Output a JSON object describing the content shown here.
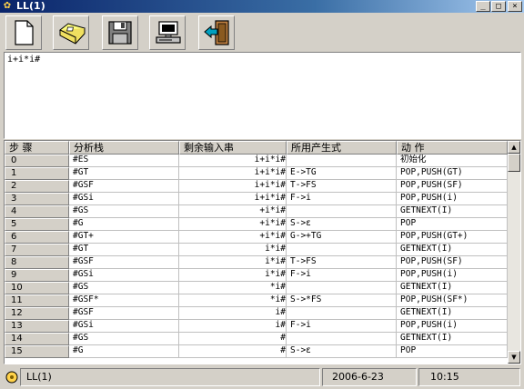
{
  "window": {
    "title": "LL(1)",
    "controls": [
      "_",
      "□",
      "×"
    ]
  },
  "toolbar": {
    "tools": [
      "new-file",
      "open-file",
      "save-file",
      "computer",
      "exit"
    ]
  },
  "editor": {
    "input_text": "i+i*i#"
  },
  "grid": {
    "headers": [
      "步  骤",
      "分析栈",
      "剩余输入串",
      "所用产生式",
      "动    作"
    ],
    "rows": [
      [
        "0",
        "#ES",
        "i+i*i#",
        "",
        "初始化"
      ],
      [
        "1",
        "#GT",
        "i+i*i#",
        "E->TG",
        "POP,PUSH(GT)"
      ],
      [
        "2",
        "#GSF",
        "i+i*i#",
        "T->FS",
        "POP,PUSH(SF)"
      ],
      [
        "3",
        "#GSi",
        "i+i*i#",
        "F->i",
        "POP,PUSH(i)"
      ],
      [
        "4",
        "#GS",
        "+i*i#",
        "",
        "GETNEXT(I)"
      ],
      [
        "5",
        "#G",
        "+i*i#",
        "S->ε",
        "POP"
      ],
      [
        "6",
        "#GT+",
        "+i*i#",
        "G->+TG",
        "POP,PUSH(GT+)"
      ],
      [
        "7",
        "#GT",
        "i*i#",
        "",
        "GETNEXT(I)"
      ],
      [
        "8",
        "#GSF",
        "i*i#",
        "T->FS",
        "POP,PUSH(SF)"
      ],
      [
        "9",
        "#GSi",
        "i*i#",
        "F->i",
        "POP,PUSH(i)"
      ],
      [
        "10",
        "#GS",
        "*i#",
        "",
        "GETNEXT(I)"
      ],
      [
        "11",
        "#GSF*",
        "*i#",
        "S->*FS",
        "POP,PUSH(SF*)"
      ],
      [
        "12",
        "#GSF",
        "i#",
        "",
        "GETNEXT(I)"
      ],
      [
        "13",
        "#GSi",
        "i#",
        "F->i",
        "POP,PUSH(i)"
      ],
      [
        "14",
        "#GS",
        "#",
        "",
        "GETNEXT(I)"
      ],
      [
        "15",
        "#G",
        "#",
        "S->ε",
        "POP"
      ]
    ]
  },
  "status": {
    "app": "LL(1)",
    "date": "2006-6-23",
    "time": "10:15"
  }
}
